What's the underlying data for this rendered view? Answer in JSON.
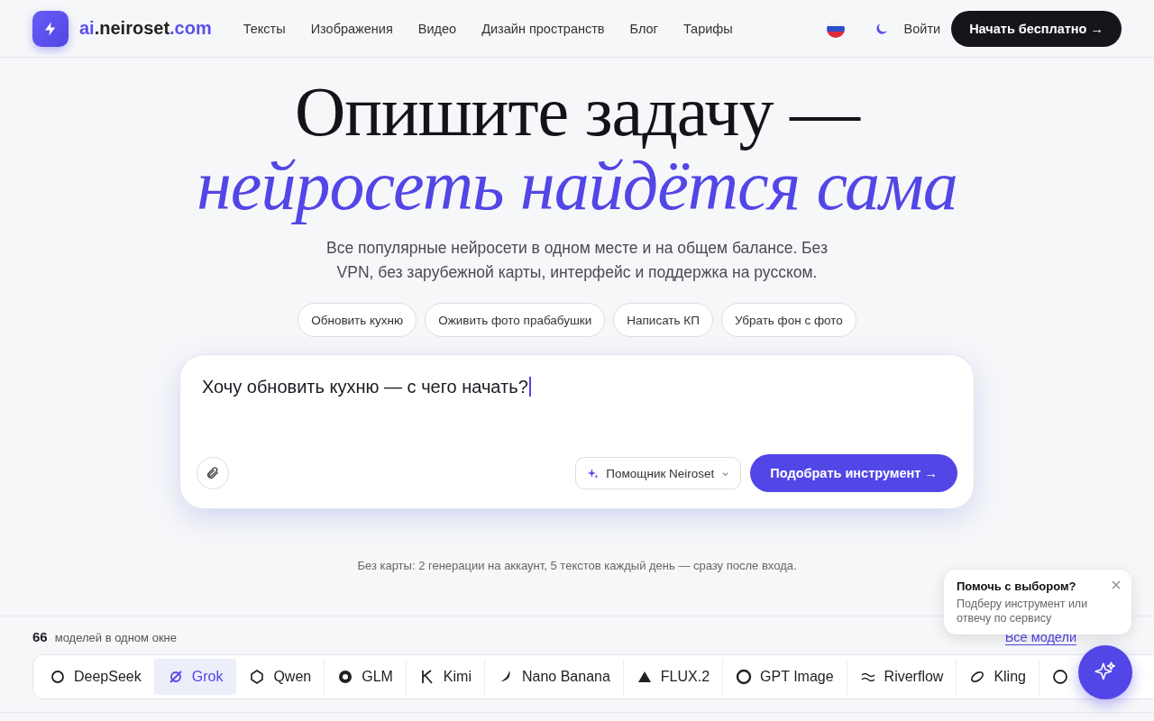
{
  "header": {
    "logo": {
      "prefix": "ai",
      "name": ".neiroset",
      "suffix": ".com"
    },
    "nav": [
      {
        "label": "Тексты"
      },
      {
        "label": "Изображения"
      },
      {
        "label": "Видео"
      },
      {
        "label": "Дизайн пространств"
      },
      {
        "label": "Блог"
      },
      {
        "label": "Тарифы"
      }
    ],
    "login": "Войти",
    "cta": "Начать бесплатно →"
  },
  "hero": {
    "title": "Опишите задачу —",
    "title_accent": "нейросеть найдётся сама",
    "subtitle": "Все популярные нейросети в одном месте и на общем балансе. Без VPN, без зарубежной карты, интерфейс и поддержка на русском.",
    "chips": [
      "Обновить кухню",
      "Оживить фото прабабушки",
      "Написать КП",
      "Убрать фон с фото"
    ]
  },
  "prompt": {
    "value": "Хочу обновить кухню — с чего начать?",
    "assistant": "Помощник Neiroset",
    "submit": "Подобрать инструмент →"
  },
  "note": "Без карты: 2 генерации на аккаунт, 5 текстов каждый день — сразу после входа.",
  "models": {
    "count": "66",
    "caption": "моделей в одном окне",
    "all_link": "Все модели",
    "tabs": [
      {
        "label": "DeepSeek",
        "selected": false
      },
      {
        "label": "Grok",
        "selected": true
      },
      {
        "label": "Qwen",
        "selected": false
      },
      {
        "label": "GLM",
        "selected": false
      },
      {
        "label": "Kimi",
        "selected": false
      },
      {
        "label": "Nano Banana",
        "selected": false
      },
      {
        "label": "FLUX.2",
        "selected": false
      },
      {
        "label": "GPT Image",
        "selected": false
      },
      {
        "label": "Riverflow",
        "selected": false
      },
      {
        "label": "Kling",
        "selected": false
      }
    ]
  },
  "help_popup": {
    "title": "Помочь с выбором?",
    "text": "Подберу инструмент или отвечу по сервису"
  }
}
